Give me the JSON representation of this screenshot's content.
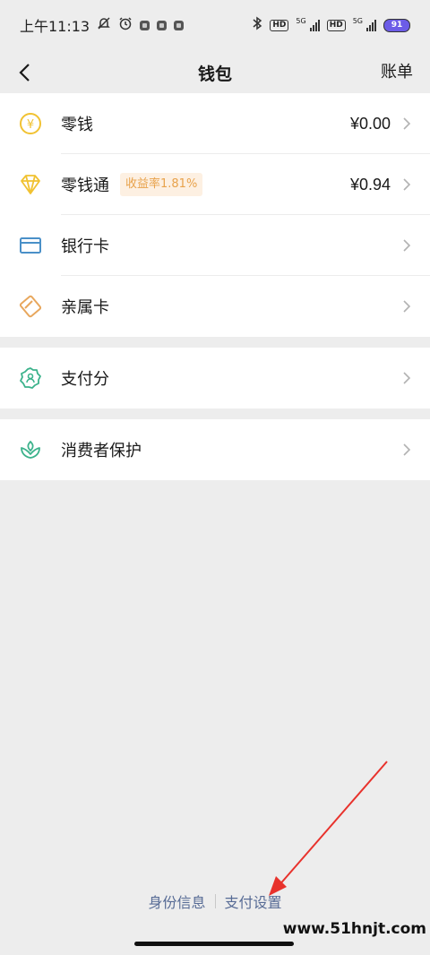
{
  "status_bar": {
    "time": "上午11:13",
    "signal_5g_a": "5G",
    "signal_5g_b": "5G",
    "hd_a": "HD",
    "hd_b": "HD",
    "battery": "91"
  },
  "nav": {
    "title": "钱包",
    "bill_label": "账单"
  },
  "rows": [
    {
      "label": "零钱",
      "value": "¥0.00",
      "icon": "coin-icon"
    },
    {
      "label": "零钱通",
      "value": "¥0.94",
      "badge": "收益率1.81%",
      "icon": "diamond-icon"
    },
    {
      "label": "银行卡",
      "icon": "bank-card-icon"
    },
    {
      "label": "亲属卡",
      "icon": "family-card-icon"
    },
    {
      "label": "支付分",
      "icon": "pay-score-icon"
    },
    {
      "label": "消费者保护",
      "icon": "consumer-protection-icon"
    }
  ],
  "footer": {
    "identity_info": "身份信息",
    "payment_settings": "支付设置"
  },
  "watermark": "www.51hnjt.com",
  "colors": {
    "background": "#ededed",
    "link": "#576b95",
    "badge_text": "#e8a24b",
    "badge_bg": "#fdf0e2",
    "arrow": "#e8322c"
  }
}
